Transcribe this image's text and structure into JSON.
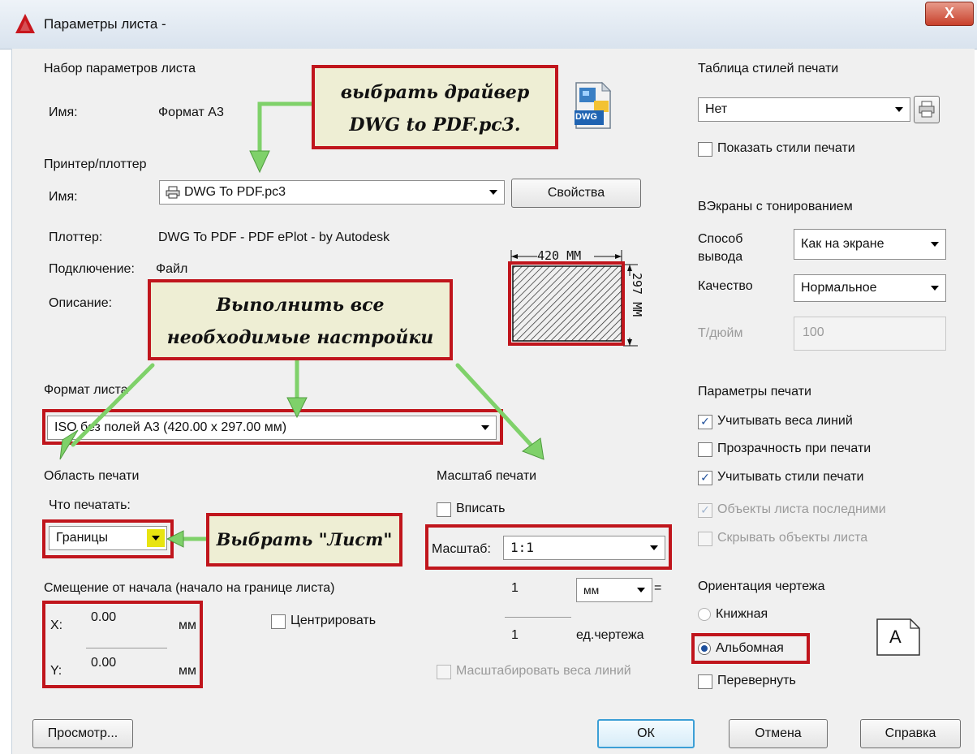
{
  "window": {
    "title": "Параметры листа -",
    "close_label": "X"
  },
  "page_setup": {
    "heading": "Набор параметров листа",
    "name_label": "Имя:",
    "name_value": "Формат А3",
    "dwg_icon_label": "DWG"
  },
  "printer": {
    "heading": "Принтер/плоттер",
    "name_label": "Имя:",
    "name_value": "DWG To PDF.pc3",
    "properties_button": "Свойства",
    "plotter_label": "Плоттер:",
    "plotter_value": "DWG To PDF - PDF ePlot - by Autodesk",
    "connection_label": "Подключение:",
    "connection_value": "Файл",
    "description_label": "Описание:",
    "preview_width": "420 MM",
    "preview_height": "297 MM"
  },
  "paper": {
    "heading": "Формат листа",
    "value": "ISO без полей A3 (420.00 x 297.00 мм)"
  },
  "plot_area": {
    "heading": "Область печати",
    "what_label": "Что печатать:",
    "what_value": "Границы"
  },
  "offset": {
    "heading": "Смещение от начала (начало на границе листа)",
    "x_label": "X:",
    "x_value": "0.00",
    "x_unit": "мм",
    "y_label": "Y:",
    "y_value": "0.00",
    "y_unit": "мм",
    "center_label": "Центрировать"
  },
  "scale": {
    "heading": "Масштаб печати",
    "fit_label": "Вписать",
    "scale_label": "Масштаб:",
    "scale_value": "1:1",
    "value1": "1",
    "unit_value": "мм",
    "equals": "=",
    "value2": "1",
    "drawing_units": "ед.чертежа",
    "lineweights_label": "Масштабировать веса линий"
  },
  "style_table": {
    "heading": "Таблица стилей печати",
    "value": "Нет",
    "show_styles_label": "Показать стили печати"
  },
  "shaded": {
    "heading": "ВЭкраны с тонированием",
    "output_label": "Способ вывода",
    "output_value": "Как на экране",
    "quality_label": "Качество",
    "quality_value": "Нормальное",
    "dpi_label": "Т/дюйм",
    "dpi_value": "100"
  },
  "plot_options": {
    "heading": "Параметры печати",
    "items": [
      {
        "label": "Учитывать веса линий",
        "checked": true
      },
      {
        "label": "Прозрачность при печати",
        "checked": false
      },
      {
        "label": "Учитывать стили печати",
        "checked": true
      },
      {
        "label": "Объекты листа последними",
        "checked": true,
        "disabled": true
      },
      {
        "label": "Скрывать объекты листа",
        "checked": false,
        "disabled": true
      }
    ]
  },
  "orientation": {
    "heading": "Ориентация чертежа",
    "portrait_label": "Книжная",
    "landscape_label": "Альбомная",
    "flip_label": "Перевернуть",
    "icon_letter": "A"
  },
  "callouts": {
    "driver": "выбрать драйвер DWG to PDF.pc3.",
    "settings": "Выполнить все необходимые настройки",
    "sheet": "Выбрать \"Лист\""
  },
  "buttons": {
    "preview": "Просмотр...",
    "ok": "ОК",
    "cancel": "Отмена",
    "help": "Справка"
  },
  "colors": {
    "annotation_red": "#c0151c",
    "arrow_green": "#7fd16a",
    "callout_bg": "#eeeed4"
  }
}
